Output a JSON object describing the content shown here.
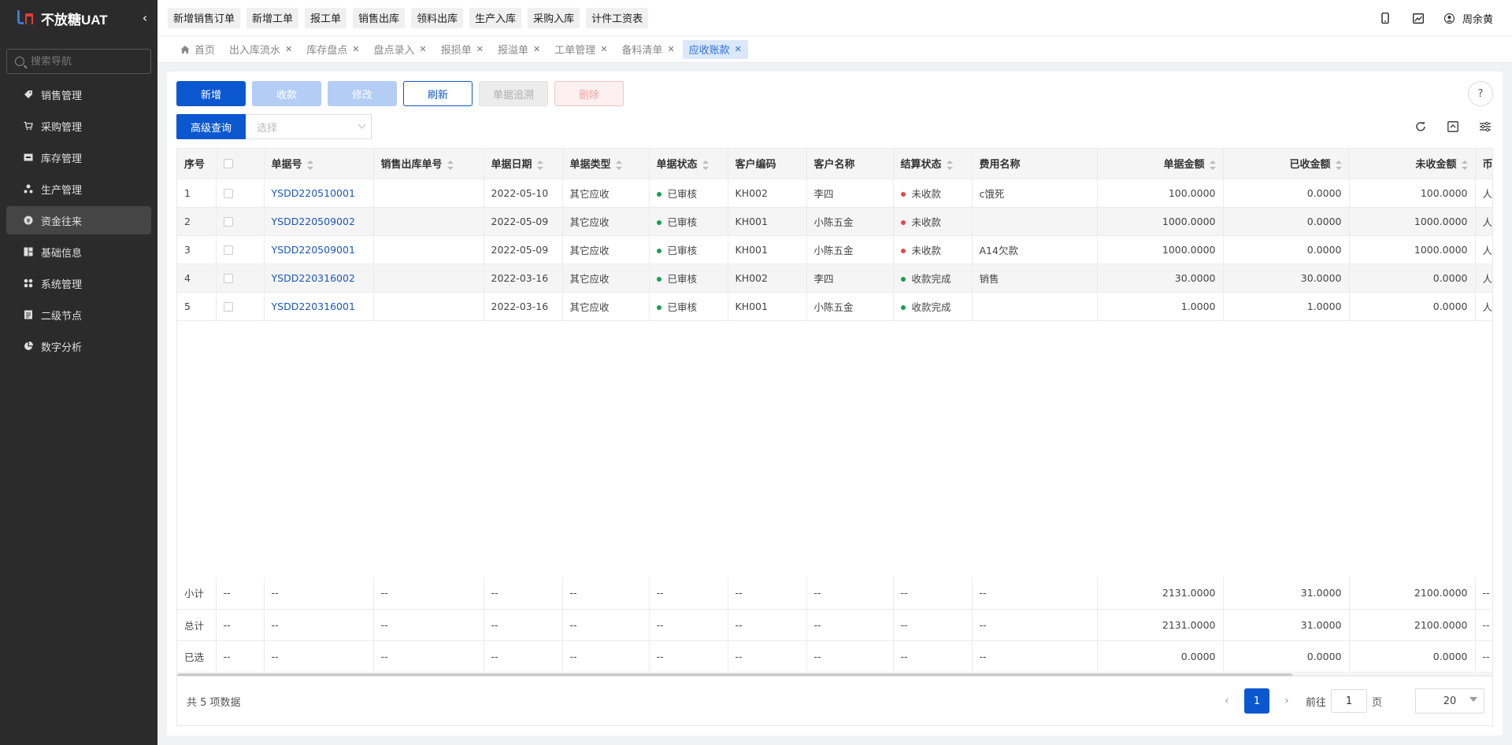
{
  "app": {
    "title": "不放糖UAT"
  },
  "sidebar": {
    "search_placeholder": "搜索导航",
    "items": [
      {
        "label": "销售管理",
        "icon": "tag-icon"
      },
      {
        "label": "采购管理",
        "icon": "cart-icon"
      },
      {
        "label": "库存管理",
        "icon": "inbox-icon"
      },
      {
        "label": "生产管理",
        "icon": "cluster-icon"
      },
      {
        "label": "资金往来",
        "icon": "money-circle-icon",
        "active": true
      },
      {
        "label": "基础信息",
        "icon": "blocks-icon"
      },
      {
        "label": "系统管理",
        "icon": "apps-icon"
      },
      {
        "label": "二级节点",
        "icon": "doc-icon"
      },
      {
        "label": "数字分析",
        "icon": "pie-chart-icon"
      }
    ]
  },
  "topbar": {
    "quick_buttons": [
      "新增销售订单",
      "新增工单",
      "报工单",
      "销售出库",
      "领料出库",
      "生产入库",
      "采购入库",
      "计件工资表"
    ],
    "user_name": "周余黄"
  },
  "tabs": [
    {
      "label": "首页",
      "closable": false
    },
    {
      "label": "出入库流水",
      "closable": true
    },
    {
      "label": "库存盘点",
      "closable": true
    },
    {
      "label": "盘点录入",
      "closable": true
    },
    {
      "label": "报损单",
      "closable": true
    },
    {
      "label": "报溢单",
      "closable": true
    },
    {
      "label": "工单管理",
      "closable": true
    },
    {
      "label": "备料清单",
      "closable": true
    },
    {
      "label": "应收账款",
      "closable": true,
      "active": true
    }
  ],
  "toolbar": {
    "add": "新增",
    "collect": "收款",
    "edit": "修改",
    "refresh": "刷新",
    "trace": "单据追溯",
    "delete": "删除"
  },
  "query": {
    "advanced": "高级查询",
    "select_placeholder": "选择"
  },
  "table": {
    "headers": [
      "序号",
      "",
      "单据号",
      "销售出库单号",
      "单据日期",
      "单据类型",
      "单据状态",
      "客户编码",
      "客户名称",
      "结算状态",
      "费用名称",
      "单据金额",
      "已收金额",
      "未收金额",
      "币"
    ],
    "rows": [
      {
        "seq": "1",
        "doc_no": "YSDD220510001",
        "out_no": "",
        "date": "2022-05-10",
        "type": "其它应收",
        "status": "已审核",
        "cust_code": "KH002",
        "cust_name": "李四",
        "settle": "未收款",
        "settle_color": "#e5484d",
        "fee": "c饿死",
        "amount": "100.0000",
        "received": "0.0000",
        "unreceived": "100.0000",
        "currency": "人"
      },
      {
        "seq": "2",
        "doc_no": "YSDD220509002",
        "out_no": "",
        "date": "2022-05-09",
        "type": "其它应收",
        "status": "已审核",
        "cust_code": "KH001",
        "cust_name": "小陈五金",
        "settle": "未收款",
        "settle_color": "#e5484d",
        "fee": "",
        "amount": "1000.0000",
        "received": "0.0000",
        "unreceived": "1000.0000",
        "currency": "人"
      },
      {
        "seq": "3",
        "doc_no": "YSDD220509001",
        "out_no": "",
        "date": "2022-05-09",
        "type": "其它应收",
        "status": "已审核",
        "cust_code": "KH001",
        "cust_name": "小陈五金",
        "settle": "未收款",
        "settle_color": "#e5484d",
        "fee": "A14欠款",
        "amount": "1000.0000",
        "received": "0.0000",
        "unreceived": "1000.0000",
        "currency": "人"
      },
      {
        "seq": "4",
        "doc_no": "YSDD220316002",
        "out_no": "",
        "date": "2022-03-16",
        "type": "其它应收",
        "status": "已审核",
        "cust_code": "KH002",
        "cust_name": "李四",
        "settle": "收款完成",
        "settle_color": "#12a150",
        "fee": "销售",
        "amount": "30.0000",
        "received": "30.0000",
        "unreceived": "0.0000",
        "currency": "人"
      },
      {
        "seq": "5",
        "doc_no": "YSDD220316001",
        "out_no": "",
        "date": "2022-03-16",
        "type": "其它应收",
        "status": "已审核",
        "cust_code": "KH001",
        "cust_name": "小陈五金",
        "settle": "收款完成",
        "settle_color": "#12a150",
        "fee": "",
        "amount": "1.0000",
        "received": "1.0000",
        "unreceived": "0.0000",
        "currency": "人"
      }
    ],
    "status_color": "#12a150",
    "summary": [
      {
        "label": "小计",
        "amount": "2131.0000",
        "received": "31.0000",
        "unreceived": "2100.0000"
      },
      {
        "label": "总计",
        "amount": "2131.0000",
        "received": "31.0000",
        "unreceived": "2100.0000"
      },
      {
        "label": "已选",
        "amount": "0.0000",
        "received": "0.0000",
        "unreceived": "0.0000"
      }
    ],
    "placeholder_dash": "--"
  },
  "footer": {
    "total_text": "共 5 项数据",
    "current_page": "1",
    "goto_label": "前往",
    "goto_value": "1",
    "page_unit": "页",
    "page_size": "20"
  }
}
